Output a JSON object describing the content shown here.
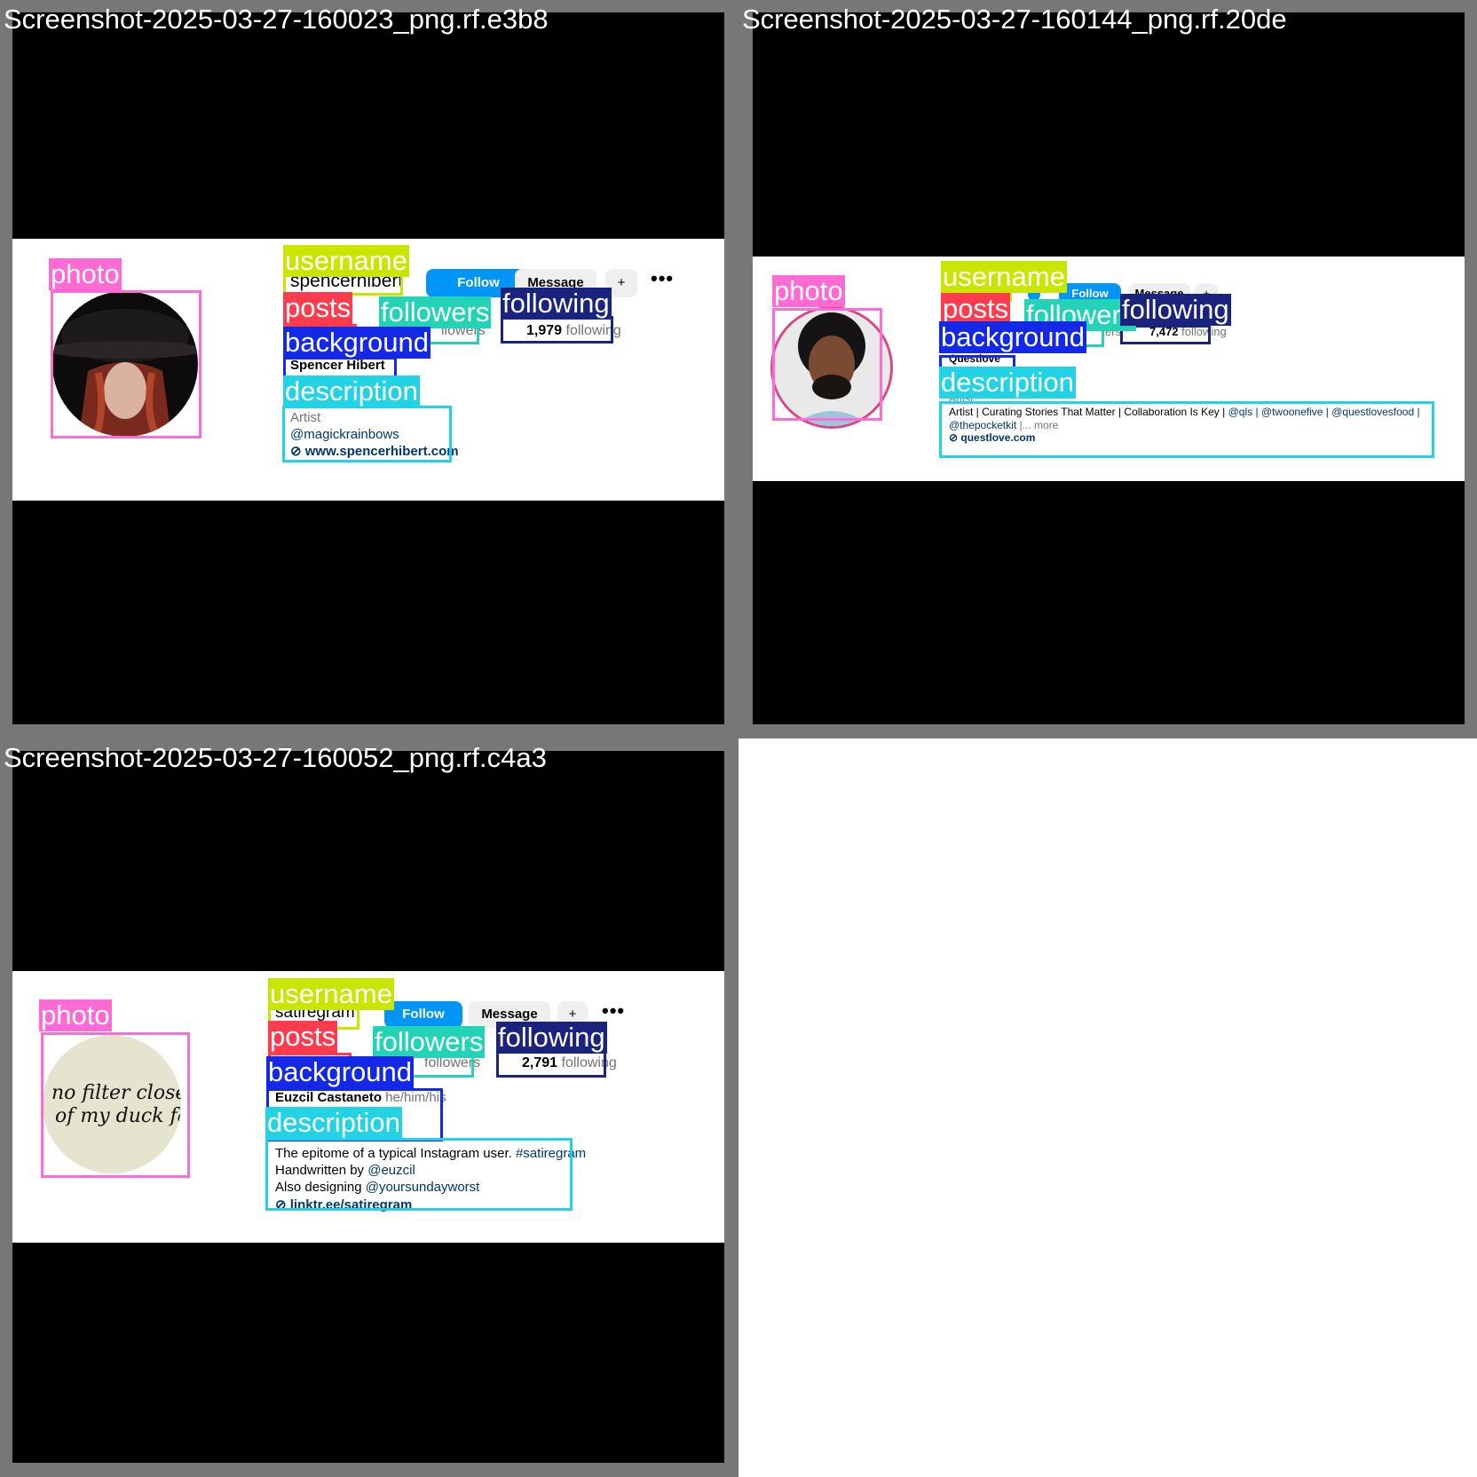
{
  "labels": {
    "photo": "photo",
    "username": "username",
    "posts": "posts",
    "followers": "followers",
    "following": "following",
    "background": "background",
    "description": "description"
  },
  "colors": {
    "photo": "#ff6ad5",
    "username": "#c8e600",
    "posts": "#ff3b4e",
    "followers": "#22d3b6",
    "following": "#1a237e",
    "background": "#1428e8",
    "description": "#22d3e6",
    "follow_button": "#0095f6"
  },
  "buttons": {
    "follow": "Follow",
    "message": "Message",
    "add_user_icon": "+",
    "more": "•••"
  },
  "tiles": [
    {
      "title": "Screenshot-2025-03-27-160023_png.rf.e3b8",
      "username": "spencerhibert",
      "followers_text": "llowers",
      "following_count": "1,979",
      "following_word": "following",
      "name": "Spencer Hibert",
      "desc": {
        "category": "Artist",
        "line1": "@magickrainbows",
        "url": "www.spencerhibert.com"
      }
    },
    {
      "title": "Screenshot-2025-03-27-160144_png.rf.20de",
      "username": "questlove",
      "followers_text": "ers",
      "following_count": "7,472",
      "following_word": "following",
      "name": "Questlove",
      "desc": {
        "category": "Artist",
        "line1_pre": "Artist | Curating Stories That Matter | Collaboration Is Key | ",
        "line1_links": "@qls | @twoonefive | @questlovesfood |",
        "line2_link": "@thepocketkit",
        "line2_more": " |... more",
        "url": "questlove.com"
      }
    },
    {
      "title": "Screenshot-2025-03-27-160052_png.rf.c4a3",
      "username": "satiregram",
      "followers_text": "followers",
      "following_count": "2,791",
      "following_word": "following",
      "name": "Euzcil Castaneto",
      "pronouns": "he/him/his",
      "desc": {
        "line1_pre": "The epitome of a typical Instagram user. ",
        "line1_link": "#satiregram",
        "line2_pre": "Handwritten by ",
        "line2_link": "@euzcil",
        "line3_pre": "Also designing ",
        "line3_link": "@yoursundayworst",
        "url": "linktr.ee/satiregram"
      },
      "photo_text": "no filter close up of my duck face."
    }
  ]
}
